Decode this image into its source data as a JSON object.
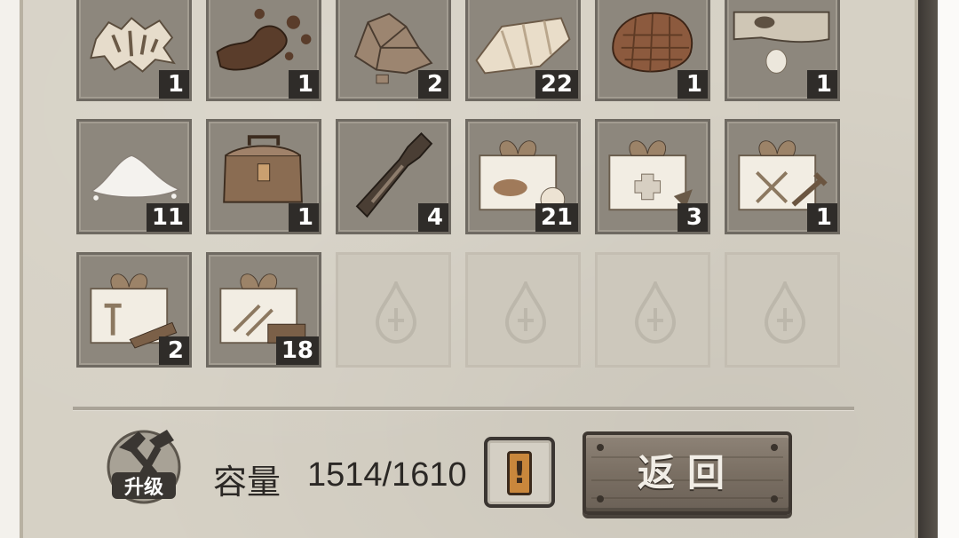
{
  "inventory": {
    "slots": [
      {
        "item": "animal-pelt",
        "count": "1"
      },
      {
        "item": "mud-splatter",
        "count": "1"
      },
      {
        "item": "rocks",
        "count": "2"
      },
      {
        "item": "raw-meat",
        "count": "22"
      },
      {
        "item": "cooked-meat",
        "count": "1"
      },
      {
        "item": "fish",
        "count": "1"
      },
      {
        "item": "salt-pile",
        "count": "11"
      },
      {
        "item": "leather-backpack",
        "count": "1"
      },
      {
        "item": "glass-bottle",
        "count": "4"
      },
      {
        "item": "food-gift-box",
        "count": "21"
      },
      {
        "item": "medical-gift-box",
        "count": "3"
      },
      {
        "item": "tool-gift-box",
        "count": "1"
      },
      {
        "item": "building-gift-box",
        "count": "2"
      },
      {
        "item": "crafting-gift-box",
        "count": "18"
      },
      {
        "item": "empty",
        "count": ""
      },
      {
        "item": "empty",
        "count": ""
      },
      {
        "item": "empty",
        "count": ""
      },
      {
        "item": "empty",
        "count": ""
      }
    ]
  },
  "footer": {
    "upgrade_label": "升级",
    "capacity_label": "容量",
    "capacity_value": "1514/1610",
    "info_icon": "exclamation-icon",
    "back_label": "返回"
  }
}
